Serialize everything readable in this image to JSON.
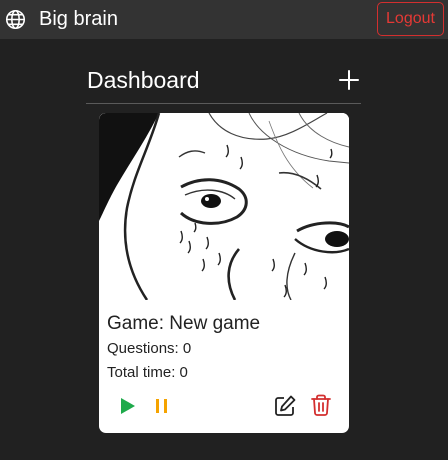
{
  "header": {
    "app_title": "Big brain",
    "logout_label": "Logout",
    "brand_icon": "globe-icon"
  },
  "dashboard": {
    "title": "Dashboard",
    "add_icon": "plus-icon"
  },
  "game_card": {
    "image_icon": "manga-face-thumbnail",
    "name": "Game: New game",
    "questions": "Questions: 0",
    "total_time": "Total time: 0",
    "actions": [
      "play-icon",
      "pause-icon",
      "edit-icon",
      "delete-icon"
    ]
  },
  "colors": {
    "background": "#212121",
    "topbar": "#333333",
    "logout": "#e53935",
    "play": "#1eaa4b",
    "pause": "#f5a300",
    "delete": "#d32f2f"
  }
}
